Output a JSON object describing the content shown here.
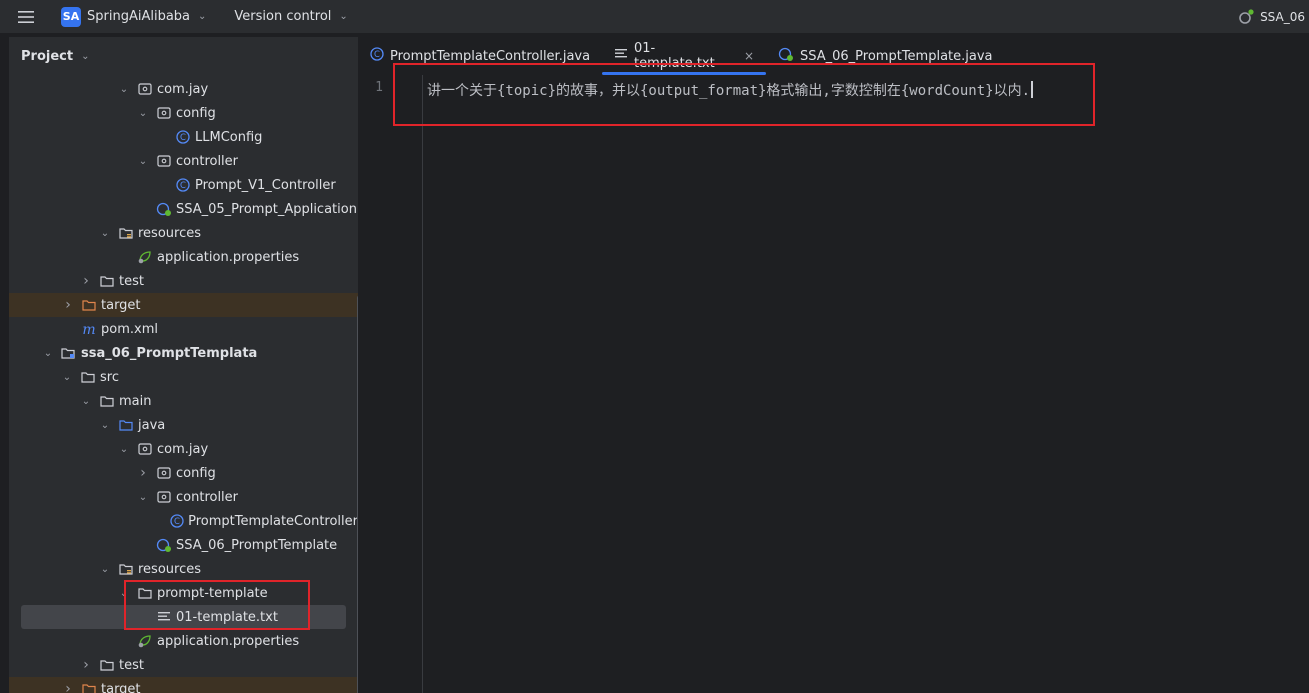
{
  "titlebar": {
    "project_badge": "SA",
    "project_name": "SpringAiAlibaba",
    "vcs_label": "Version control",
    "run_config": "SSA_06"
  },
  "project_panel": {
    "title": "Project",
    "tree": [
      {
        "label": "com.jay",
        "icon": "package-icon",
        "arrow": "down"
      },
      {
        "label": "config",
        "icon": "package-icon",
        "arrow": "down"
      },
      {
        "label": "LLMConfig",
        "icon": "class-icon",
        "arrow": ""
      },
      {
        "label": "controller",
        "icon": "package-icon",
        "arrow": "down"
      },
      {
        "label": "Prompt_V1_Controller",
        "icon": "class-icon",
        "arrow": ""
      },
      {
        "label": "SSA_05_Prompt_Application",
        "icon": "spring-app-icon",
        "arrow": ""
      },
      {
        "label": "resources",
        "icon": "resources-folder-icon",
        "arrow": "down"
      },
      {
        "label": "application.properties",
        "icon": "properties-icon",
        "arrow": ""
      },
      {
        "label": "test",
        "icon": "folder-icon",
        "arrow": "right"
      },
      {
        "label": "target",
        "icon": "target-folder-icon",
        "arrow": "right"
      },
      {
        "label": "pom.xml",
        "icon": "maven-icon",
        "arrow": ""
      },
      {
        "label": "ssa_06_PromptTemplata",
        "icon": "module-icon",
        "arrow": "down"
      },
      {
        "label": "src",
        "icon": "folder-icon",
        "arrow": "down"
      },
      {
        "label": "main",
        "icon": "folder-icon",
        "arrow": "down"
      },
      {
        "label": "java",
        "icon": "source-folder-icon",
        "arrow": "down"
      },
      {
        "label": "com.jay",
        "icon": "package-icon",
        "arrow": "down"
      },
      {
        "label": "config",
        "icon": "package-icon",
        "arrow": "right"
      },
      {
        "label": "controller",
        "icon": "package-icon",
        "arrow": "down"
      },
      {
        "label": "PromptTemplateController",
        "icon": "class-icon",
        "arrow": ""
      },
      {
        "label": "SSA_06_PromptTemplate",
        "icon": "spring-app-icon",
        "arrow": ""
      },
      {
        "label": "resources",
        "icon": "resources-folder-icon",
        "arrow": "down"
      },
      {
        "label": "prompt-template",
        "icon": "folder-icon",
        "arrow": "down"
      },
      {
        "label": "01-template.txt",
        "icon": "text-file-icon",
        "arrow": ""
      },
      {
        "label": "application.properties",
        "icon": "properties-icon",
        "arrow": ""
      },
      {
        "label": "test",
        "icon": "folder-icon",
        "arrow": "right"
      },
      {
        "label": "target",
        "icon": "target-folder-icon",
        "arrow": "right"
      }
    ]
  },
  "editor": {
    "tabs": [
      {
        "label": "PromptTemplateController.java",
        "icon": "class-icon"
      },
      {
        "label": "01-template.txt",
        "icon": "text-file-icon",
        "close": "×"
      },
      {
        "label": "SSA_06_PromptTemplate.java",
        "icon": "spring-app-icon"
      }
    ],
    "line_number": "1",
    "line_text": "讲一个关于{topic}的故事，并以{output_format}格式输出,字数控制在{wordCount}以内."
  },
  "colors": {
    "accent": "#3574f0",
    "annotation_red": "#e0242a",
    "target_highlight": "#3d3223"
  }
}
